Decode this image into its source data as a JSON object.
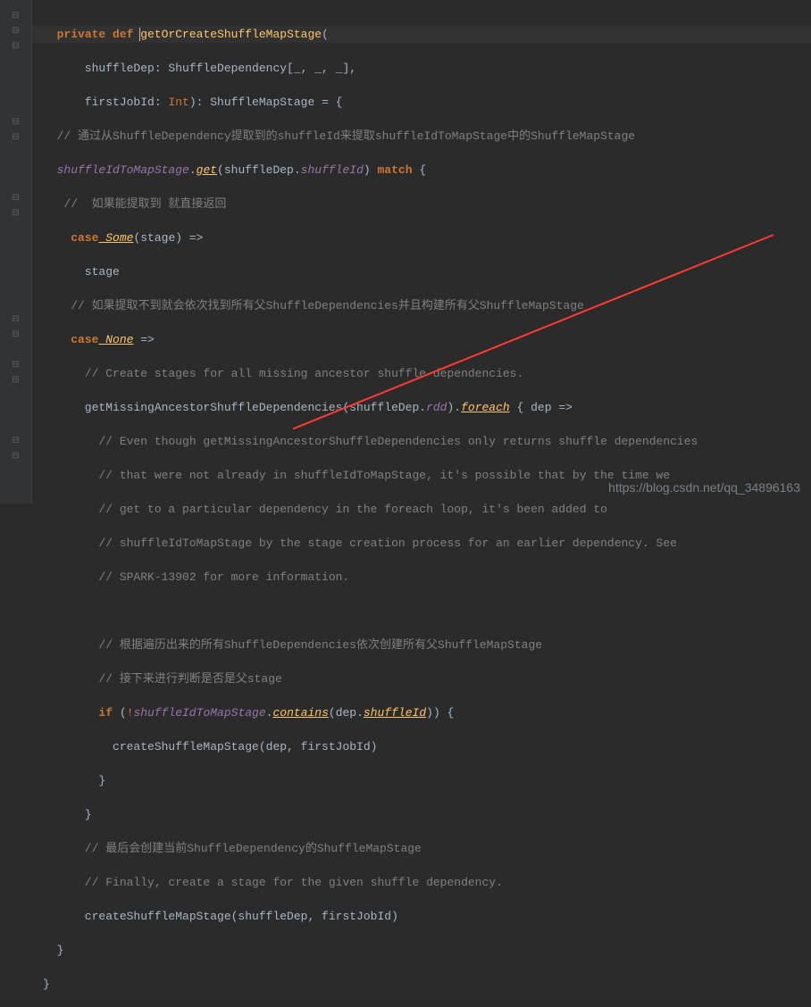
{
  "code": {
    "line1_private": "private",
    "line1_def": "def",
    "line1_method": "getOrCreateShuffleMapStage",
    "line1_open": "(",
    "line2": "      shuffleDep: ShuffleDependency[_, _, _],",
    "line3_a": "      firstJobId: ",
    "line3_int": "Int",
    "line3_b": "): ShuffleMapStage = {",
    "line4": "  // 通过从ShuffleDependency提取到的shuffleId来提取shuffleIdToMapStage中的ShuffleMapStage",
    "line5_var": "  shuffleIdToMapStage",
    "line5_dot": ".",
    "line5_get": "get",
    "line5_args_a": "(shuffleDep.",
    "line5_shuffleid": "shuffleId",
    "line5_close": ") ",
    "line5_match": "match",
    "line5_brace": " {",
    "line6": "   //  如果能提取到 就直接返回",
    "line7_case": "    case",
    "line7_some": " Some",
    "line7_rest": "(stage) =>",
    "line8": "      stage",
    "line9": "    // 如果提取不到就会依次找到所有父ShuffleDependencies并且构建所有父ShuffleMapStage",
    "line10_case": "    case",
    "line10_none": " None",
    "line10_rest": " =>",
    "line11": "      // Create stages for all missing ancestor shuffle dependencies.",
    "line12_a": "      getMissingAncestorShuffleDependencies(shuffleDep.",
    "line12_rdd": "rdd",
    "line12_b": ").",
    "line12_foreach": "foreach",
    "line12_c": " { dep =>",
    "line13": "        // Even though getMissingAncestorShuffleDependencies only returns shuffle dependencies",
    "line14": "        // that were not already in shuffleIdToMapStage, it's possible that by the time we",
    "line15": "        // get to a particular dependency in the foreach loop, it's been added to",
    "line16": "        // shuffleIdToMapStage by the stage creation process for an earlier dependency. See",
    "line17": "        // SPARK-13902 for more information.",
    "line18": "",
    "line19": "        // 根据遍历出来的所有ShuffleDependencies依次创建所有父ShuffleMapStage",
    "line20": "        // 接下来进行判断是否是父stage",
    "line21_if": "        if",
    "line21_a": " (",
    "line21_not": "!",
    "line21_var": "shuffleIdToMapStage",
    "line21_dot": ".",
    "line21_contains": "contains",
    "line21_b": "(dep.",
    "line21_sid": "shuffleId",
    "line21_c": ")) {",
    "line22": "          createShuffleMapStage(dep, firstJobId)",
    "line23": "        }",
    "line24": "      }",
    "line25": "      // 最后会创建当前ShuffleDependency的ShuffleMapStage",
    "line26": "      // Finally, create a stage for the given shuffle dependency.",
    "line27": "      createShuffleMapStage(shuffleDep, firstJobId)",
    "line28": "  }",
    "line29": "}"
  },
  "watermark": "https://blog.csdn.net/qq_34896163",
  "fold_markers": [
    "⊟",
    "⊟",
    "⊟",
    "",
    "",
    "",
    "",
    "⊟",
    "⊟",
    "",
    "",
    "",
    "⊟",
    "⊟",
    "",
    "",
    "",
    "",
    "",
    "",
    "⊟",
    "⊟",
    "",
    "⊟",
    "⊟",
    "",
    "",
    "",
    "⊟",
    "⊟"
  ]
}
